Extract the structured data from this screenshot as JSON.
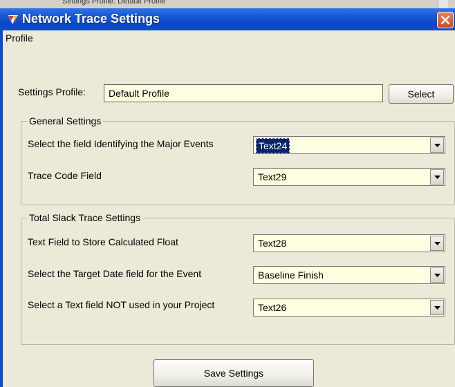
{
  "window": {
    "title": "Network Trace Settings",
    "behind_text": "Settings Profile: Default Profile"
  },
  "menu": {
    "items": [
      "Profile"
    ]
  },
  "profile": {
    "label": "Settings Profile:",
    "value": "Default Profile",
    "select_label": "Select"
  },
  "general": {
    "legend": "General Settings",
    "rows": [
      {
        "label": "Select the field Identifying the Major Events",
        "value": "Text24"
      },
      {
        "label": "Trace Code Field",
        "value": "Text29"
      }
    ]
  },
  "slack": {
    "legend": "Total Slack Trace Settings",
    "rows": [
      {
        "label": "Text Field to Store Calculated Float",
        "value": "Text28"
      },
      {
        "label": "Select the Target Date field for the Event",
        "value": "Baseline Finish"
      },
      {
        "label": "Select a Text field NOT  used in your Project",
        "value": "Text26"
      }
    ]
  },
  "save_label": "Save Settings",
  "colors": {
    "titlebar": "#0c4bd0",
    "dialog_bg": "#ece9d8",
    "input_bg": "#ffffe1",
    "selection": "#0a246a",
    "close": "#d24a1e"
  }
}
